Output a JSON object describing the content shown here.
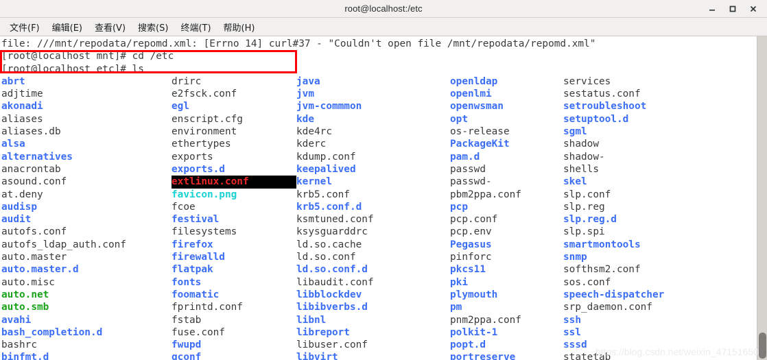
{
  "window": {
    "title": "root@localhost:/etc",
    "controls": [
      {
        "name": "minimize",
        "label": "–"
      },
      {
        "name": "maximize",
        "label": "□"
      },
      {
        "name": "close",
        "label": "✕"
      }
    ]
  },
  "menubar": {
    "items": [
      "文件(F)",
      "编辑(E)",
      "查看(V)",
      "搜索(S)",
      "终端(T)",
      "帮助(H)"
    ]
  },
  "colors": {
    "dir": "#3b6ef5",
    "link": "#19d2d2",
    "exec": "#19a319",
    "orphan_fg": "#ef2929",
    "orphan_bg": "#000000",
    "plain": "#3b3b3b",
    "annotation": "#fb0007"
  },
  "terminal": {
    "error_line": "file: ///mnt/repodata/repomd.xml: [Errno 14] curl#37 - \"Couldn't open file /mnt/repodata/repomd.xml\"",
    "prompt_lines": [
      "[root@localhost mnt]# cd /etc",
      "[root@localhost etc]# ls"
    ],
    "ls_rows": [
      [
        {
          "t": "abrt",
          "k": "dir"
        },
        {
          "t": "drirc",
          "k": "plain"
        },
        {
          "t": "java",
          "k": "dir"
        },
        {
          "t": "openldap",
          "k": "dir"
        },
        {
          "t": "services",
          "k": "plain"
        }
      ],
      [
        {
          "t": "adjtime",
          "k": "plain"
        },
        {
          "t": "e2fsck.conf",
          "k": "plain"
        },
        {
          "t": "jvm",
          "k": "dir"
        },
        {
          "t": "openlmi",
          "k": "dir"
        },
        {
          "t": "sestatus.conf",
          "k": "plain"
        }
      ],
      [
        {
          "t": "akonadi",
          "k": "dir"
        },
        {
          "t": "egl",
          "k": "dir"
        },
        {
          "t": "jvm-commmon",
          "k": "dir"
        },
        {
          "t": "openwsman",
          "k": "dir"
        },
        {
          "t": "setroubleshoot",
          "k": "dir"
        }
      ],
      [
        {
          "t": "aliases",
          "k": "plain"
        },
        {
          "t": "enscript.cfg",
          "k": "plain"
        },
        {
          "t": "kde",
          "k": "dir"
        },
        {
          "t": "opt",
          "k": "dir"
        },
        {
          "t": "setuptool.d",
          "k": "dir"
        }
      ],
      [
        {
          "t": "aliases.db",
          "k": "plain"
        },
        {
          "t": "environment",
          "k": "plain"
        },
        {
          "t": "kde4rc",
          "k": "plain"
        },
        {
          "t": "os-release",
          "k": "plain"
        },
        {
          "t": "sgml",
          "k": "dir"
        }
      ],
      [
        {
          "t": "alsa",
          "k": "dir"
        },
        {
          "t": "ethertypes",
          "k": "plain"
        },
        {
          "t": "kderc",
          "k": "plain"
        },
        {
          "t": "PackageKit",
          "k": "dir"
        },
        {
          "t": "shadow",
          "k": "plain"
        }
      ],
      [
        {
          "t": "alternatives",
          "k": "dir"
        },
        {
          "t": "exports",
          "k": "plain"
        },
        {
          "t": "kdump.conf",
          "k": "plain"
        },
        {
          "t": "pam.d",
          "k": "dir"
        },
        {
          "t": "shadow-",
          "k": "plain"
        }
      ],
      [
        {
          "t": "anacrontab",
          "k": "plain"
        },
        {
          "t": "exports.d",
          "k": "dir"
        },
        {
          "t": "keepalived",
          "k": "dir"
        },
        {
          "t": "passwd",
          "k": "plain"
        },
        {
          "t": "shells",
          "k": "plain"
        }
      ],
      [
        {
          "t": "asound.conf",
          "k": "plain"
        },
        {
          "t": "extlinux.conf",
          "k": "orphan"
        },
        {
          "t": "kernel",
          "k": "dir"
        },
        {
          "t": "passwd-",
          "k": "plain"
        },
        {
          "t": "skel",
          "k": "dir"
        }
      ],
      [
        {
          "t": "at.deny",
          "k": "plain"
        },
        {
          "t": "favicon.png",
          "k": "link"
        },
        {
          "t": "krb5.conf",
          "k": "plain"
        },
        {
          "t": "pbm2ppa.conf",
          "k": "plain"
        },
        {
          "t": "slp.conf",
          "k": "plain"
        }
      ],
      [
        {
          "t": "audisp",
          "k": "dir"
        },
        {
          "t": "fcoe",
          "k": "plain"
        },
        {
          "t": "krb5.conf.d",
          "k": "dir"
        },
        {
          "t": "pcp",
          "k": "dir"
        },
        {
          "t": "slp.reg",
          "k": "plain"
        }
      ],
      [
        {
          "t": "audit",
          "k": "dir"
        },
        {
          "t": "festival",
          "k": "dir"
        },
        {
          "t": "ksmtuned.conf",
          "k": "plain"
        },
        {
          "t": "pcp.conf",
          "k": "plain"
        },
        {
          "t": "slp.reg.d",
          "k": "dir"
        }
      ],
      [
        {
          "t": "autofs.conf",
          "k": "plain"
        },
        {
          "t": "filesystems",
          "k": "plain"
        },
        {
          "t": "ksysguarddrc",
          "k": "plain"
        },
        {
          "t": "pcp.env",
          "k": "plain"
        },
        {
          "t": "slp.spi",
          "k": "plain"
        }
      ],
      [
        {
          "t": "autofs_ldap_auth.conf",
          "k": "plain"
        },
        {
          "t": "firefox",
          "k": "dir"
        },
        {
          "t": "ld.so.cache",
          "k": "plain"
        },
        {
          "t": "Pegasus",
          "k": "dir"
        },
        {
          "t": "smartmontools",
          "k": "dir"
        }
      ],
      [
        {
          "t": "auto.master",
          "k": "plain"
        },
        {
          "t": "firewalld",
          "k": "dir"
        },
        {
          "t": "ld.so.conf",
          "k": "plain"
        },
        {
          "t": "pinforc",
          "k": "plain"
        },
        {
          "t": "snmp",
          "k": "dir"
        }
      ],
      [
        {
          "t": "auto.master.d",
          "k": "dir"
        },
        {
          "t": "flatpak",
          "k": "dir"
        },
        {
          "t": "ld.so.conf.d",
          "k": "dir"
        },
        {
          "t": "pkcs11",
          "k": "dir"
        },
        {
          "t": "softhsm2.conf",
          "k": "plain"
        }
      ],
      [
        {
          "t": "auto.misc",
          "k": "plain"
        },
        {
          "t": "fonts",
          "k": "dir"
        },
        {
          "t": "libaudit.conf",
          "k": "plain"
        },
        {
          "t": "pki",
          "k": "dir"
        },
        {
          "t": "sos.conf",
          "k": "plain"
        }
      ],
      [
        {
          "t": "auto.net",
          "k": "exec"
        },
        {
          "t": "foomatic",
          "k": "dir"
        },
        {
          "t": "libblockdev",
          "k": "dir"
        },
        {
          "t": "plymouth",
          "k": "dir"
        },
        {
          "t": "speech-dispatcher",
          "k": "dir"
        }
      ],
      [
        {
          "t": "auto.smb",
          "k": "exec"
        },
        {
          "t": "fprintd.conf",
          "k": "plain"
        },
        {
          "t": "libibverbs.d",
          "k": "dir"
        },
        {
          "t": "pm",
          "k": "dir"
        },
        {
          "t": "srp_daemon.conf",
          "k": "plain"
        }
      ],
      [
        {
          "t": "avahi",
          "k": "dir"
        },
        {
          "t": "fstab",
          "k": "plain"
        },
        {
          "t": "libnl",
          "k": "dir"
        },
        {
          "t": "pnm2ppa.conf",
          "k": "plain"
        },
        {
          "t": "ssh",
          "k": "dir"
        }
      ],
      [
        {
          "t": "bash_completion.d",
          "k": "dir"
        },
        {
          "t": "fuse.conf",
          "k": "plain"
        },
        {
          "t": "libreport",
          "k": "dir"
        },
        {
          "t": "polkit-1",
          "k": "dir"
        },
        {
          "t": "ssl",
          "k": "dir"
        }
      ],
      [
        {
          "t": "bashrc",
          "k": "plain"
        },
        {
          "t": "fwupd",
          "k": "dir"
        },
        {
          "t": "libuser.conf",
          "k": "plain"
        },
        {
          "t": "popt.d",
          "k": "dir"
        },
        {
          "t": "sssd",
          "k": "dir"
        }
      ],
      [
        {
          "t": "binfmt.d",
          "k": "dir"
        },
        {
          "t": "gconf",
          "k": "dir"
        },
        {
          "t": "libvirt",
          "k": "dir"
        },
        {
          "t": "portreserve",
          "k": "dir"
        },
        {
          "t": "statetab",
          "k": "plain"
        }
      ]
    ]
  },
  "watermark": {
    "text": "https://blog.csdn.net/weixin_47151650"
  }
}
